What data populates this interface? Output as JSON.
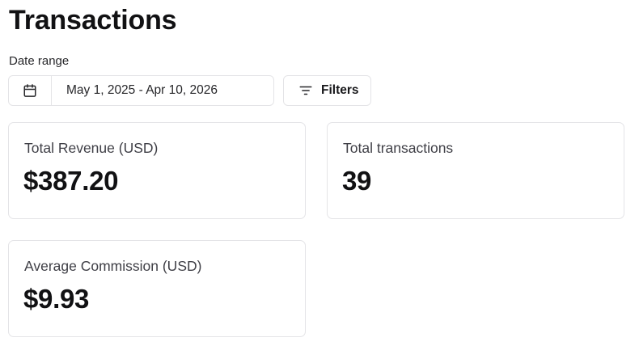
{
  "page": {
    "title": "Transactions"
  },
  "date_range": {
    "label": "Date range",
    "value": "May 1, 2025 - Apr 10, 2026",
    "icon": "calendar-icon"
  },
  "filters": {
    "label": "Filters",
    "icon": "filter-lines-icon"
  },
  "stats": [
    {
      "label": "Total Revenue (USD)",
      "value": "$387.20"
    },
    {
      "label": "Total transactions",
      "value": "39"
    },
    {
      "label": "Average Commission (USD)",
      "value": "$9.93"
    }
  ],
  "colors": {
    "border": "#e4e4e7",
    "text_primary": "#111113",
    "text_secondary": "#3f3f46"
  }
}
